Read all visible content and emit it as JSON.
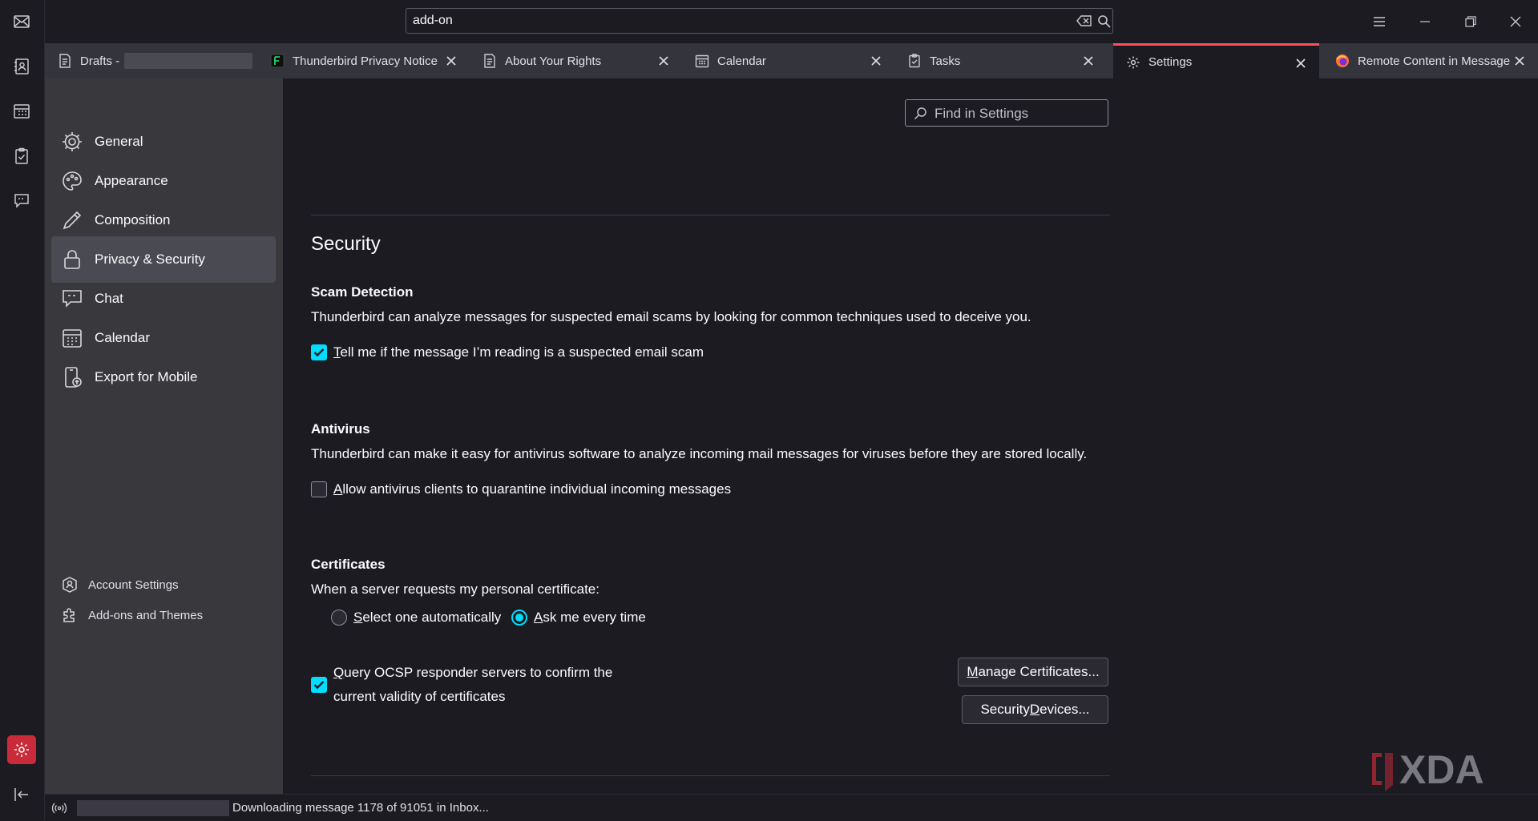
{
  "app": {
    "search": {
      "value": "add-on"
    },
    "colors": {
      "accent": "#00ddff",
      "active_tab": "#ff4f5e",
      "settings_space": "#c92b3a"
    }
  },
  "spaces": [
    {
      "name": "mail",
      "icon": "envelope-icon"
    },
    {
      "name": "address-book",
      "icon": "address-book-icon"
    },
    {
      "name": "calendar",
      "icon": "calendar-icon"
    },
    {
      "name": "tasks",
      "icon": "tasks-icon"
    },
    {
      "name": "chat",
      "icon": "chat-icon"
    },
    {
      "name": "settings",
      "icon": "gear-icon"
    },
    {
      "name": "collapse",
      "icon": "collapse-icon"
    }
  ],
  "tabs": [
    {
      "label": "Drafts - ",
      "icon": "document-icon"
    },
    {
      "label": "Thunderbird Privacy Notice",
      "icon": "page-icon"
    },
    {
      "label": "About Your Rights",
      "icon": "document-icon"
    },
    {
      "label": "Calendar",
      "icon": "calendar-icon"
    },
    {
      "label": "Tasks",
      "icon": "tasks-icon"
    },
    {
      "label": "Settings",
      "icon": "gear-icon",
      "active": true
    },
    {
      "label": "Remote Content in Message",
      "icon": "firefox-icon"
    }
  ],
  "nav": {
    "items": [
      {
        "label": "General",
        "icon": "gear-icon"
      },
      {
        "label": "Appearance",
        "icon": "palette-icon"
      },
      {
        "label": "Composition",
        "icon": "pencil-icon"
      },
      {
        "label": "Privacy & Security",
        "icon": "lock-icon",
        "active": true
      },
      {
        "label": "Chat",
        "icon": "chat-icon"
      },
      {
        "label": "Calendar",
        "icon": "calendar-icon"
      },
      {
        "label": "Export for Mobile",
        "icon": "mobile-icon"
      }
    ],
    "footer": [
      {
        "label": "Account Settings",
        "icon": "account-icon"
      },
      {
        "label": "Add-ons and Themes",
        "icon": "puzzle-icon"
      }
    ]
  },
  "main": {
    "find_placeholder": "Find in Settings",
    "section_title": "Security",
    "scam": {
      "title": "Scam Detection",
      "description": "Thunderbird can analyze messages for suspected email scams by looking for common techniques used to deceive you.",
      "checkbox_key": "T",
      "checkbox_rest": "ell me if the message I’m reading is a suspected email scam",
      "checked": true
    },
    "antivirus": {
      "title": "Antivirus",
      "description": "Thunderbird can make it easy for antivirus software to analyze incoming mail messages for viruses before they are stored locally.",
      "checkbox_key": "A",
      "checkbox_rest": "llow antivirus clients to quarantine individual incoming messages",
      "checked": false
    },
    "certificates": {
      "title": "Certificates",
      "prompt": "When a server requests my personal certificate:",
      "radio1_key": "S",
      "radio1_rest": "elect one automatically",
      "radio2_key": "A",
      "radio2_rest": "sk me every time",
      "selected": "ask",
      "ocsp_key": "Q",
      "ocsp_line1_rest": "uery OCSP responder servers to confirm the",
      "ocsp_line2": "current validity of certificates",
      "ocsp_checked": true,
      "manage_key": "M",
      "manage_rest": "anage Certificates...",
      "devices_pre": "Security ",
      "devices_key": "D",
      "devices_rest": "evices..."
    }
  },
  "status": {
    "text": "Downloading message 1178 of 91051 in Inbox..."
  },
  "watermark": "XDA"
}
